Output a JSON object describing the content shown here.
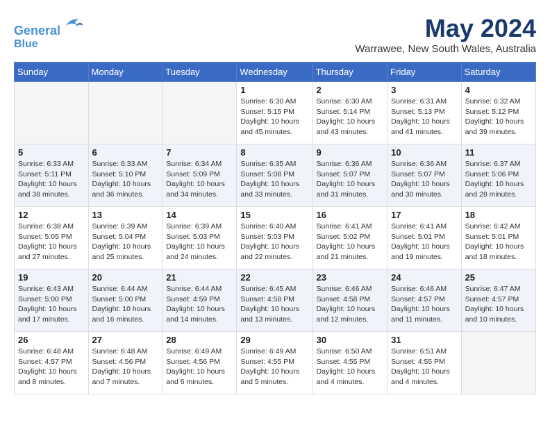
{
  "header": {
    "logo_line1": "General",
    "logo_line2": "Blue",
    "month": "May 2024",
    "location": "Warrawee, New South Wales, Australia"
  },
  "weekdays": [
    "Sunday",
    "Monday",
    "Tuesday",
    "Wednesday",
    "Thursday",
    "Friday",
    "Saturday"
  ],
  "weeks": [
    [
      {
        "day": "",
        "sunrise": "",
        "sunset": "",
        "daylight": ""
      },
      {
        "day": "",
        "sunrise": "",
        "sunset": "",
        "daylight": ""
      },
      {
        "day": "",
        "sunrise": "",
        "sunset": "",
        "daylight": ""
      },
      {
        "day": "1",
        "sunrise": "Sunrise: 6:30 AM",
        "sunset": "Sunset: 5:15 PM",
        "daylight": "Daylight: 10 hours and 45 minutes."
      },
      {
        "day": "2",
        "sunrise": "Sunrise: 6:30 AM",
        "sunset": "Sunset: 5:14 PM",
        "daylight": "Daylight: 10 hours and 43 minutes."
      },
      {
        "day": "3",
        "sunrise": "Sunrise: 6:31 AM",
        "sunset": "Sunset: 5:13 PM",
        "daylight": "Daylight: 10 hours and 41 minutes."
      },
      {
        "day": "4",
        "sunrise": "Sunrise: 6:32 AM",
        "sunset": "Sunset: 5:12 PM",
        "daylight": "Daylight: 10 hours and 39 minutes."
      }
    ],
    [
      {
        "day": "5",
        "sunrise": "Sunrise: 6:33 AM",
        "sunset": "Sunset: 5:11 PM",
        "daylight": "Daylight: 10 hours and 38 minutes."
      },
      {
        "day": "6",
        "sunrise": "Sunrise: 6:33 AM",
        "sunset": "Sunset: 5:10 PM",
        "daylight": "Daylight: 10 hours and 36 minutes."
      },
      {
        "day": "7",
        "sunrise": "Sunrise: 6:34 AM",
        "sunset": "Sunset: 5:09 PM",
        "daylight": "Daylight: 10 hours and 34 minutes."
      },
      {
        "day": "8",
        "sunrise": "Sunrise: 6:35 AM",
        "sunset": "Sunset: 5:08 PM",
        "daylight": "Daylight: 10 hours and 33 minutes."
      },
      {
        "day": "9",
        "sunrise": "Sunrise: 6:36 AM",
        "sunset": "Sunset: 5:07 PM",
        "daylight": "Daylight: 10 hours and 31 minutes."
      },
      {
        "day": "10",
        "sunrise": "Sunrise: 6:36 AM",
        "sunset": "Sunset: 5:07 PM",
        "daylight": "Daylight: 10 hours and 30 minutes."
      },
      {
        "day": "11",
        "sunrise": "Sunrise: 6:37 AM",
        "sunset": "Sunset: 5:06 PM",
        "daylight": "Daylight: 10 hours and 28 minutes."
      }
    ],
    [
      {
        "day": "12",
        "sunrise": "Sunrise: 6:38 AM",
        "sunset": "Sunset: 5:05 PM",
        "daylight": "Daylight: 10 hours and 27 minutes."
      },
      {
        "day": "13",
        "sunrise": "Sunrise: 6:39 AM",
        "sunset": "Sunset: 5:04 PM",
        "daylight": "Daylight: 10 hours and 25 minutes."
      },
      {
        "day": "14",
        "sunrise": "Sunrise: 6:39 AM",
        "sunset": "Sunset: 5:03 PM",
        "daylight": "Daylight: 10 hours and 24 minutes."
      },
      {
        "day": "15",
        "sunrise": "Sunrise: 6:40 AM",
        "sunset": "Sunset: 5:03 PM",
        "daylight": "Daylight: 10 hours and 22 minutes."
      },
      {
        "day": "16",
        "sunrise": "Sunrise: 6:41 AM",
        "sunset": "Sunset: 5:02 PM",
        "daylight": "Daylight: 10 hours and 21 minutes."
      },
      {
        "day": "17",
        "sunrise": "Sunrise: 6:41 AM",
        "sunset": "Sunset: 5:01 PM",
        "daylight": "Daylight: 10 hours and 19 minutes."
      },
      {
        "day": "18",
        "sunrise": "Sunrise: 6:42 AM",
        "sunset": "Sunset: 5:01 PM",
        "daylight": "Daylight: 10 hours and 18 minutes."
      }
    ],
    [
      {
        "day": "19",
        "sunrise": "Sunrise: 6:43 AM",
        "sunset": "Sunset: 5:00 PM",
        "daylight": "Daylight: 10 hours and 17 minutes."
      },
      {
        "day": "20",
        "sunrise": "Sunrise: 6:44 AM",
        "sunset": "Sunset: 5:00 PM",
        "daylight": "Daylight: 10 hours and 16 minutes."
      },
      {
        "day": "21",
        "sunrise": "Sunrise: 6:44 AM",
        "sunset": "Sunset: 4:59 PM",
        "daylight": "Daylight: 10 hours and 14 minutes."
      },
      {
        "day": "22",
        "sunrise": "Sunrise: 6:45 AM",
        "sunset": "Sunset: 4:58 PM",
        "daylight": "Daylight: 10 hours and 13 minutes."
      },
      {
        "day": "23",
        "sunrise": "Sunrise: 6:46 AM",
        "sunset": "Sunset: 4:58 PM",
        "daylight": "Daylight: 10 hours and 12 minutes."
      },
      {
        "day": "24",
        "sunrise": "Sunrise: 6:46 AM",
        "sunset": "Sunset: 4:57 PM",
        "daylight": "Daylight: 10 hours and 11 minutes."
      },
      {
        "day": "25",
        "sunrise": "Sunrise: 6:47 AM",
        "sunset": "Sunset: 4:57 PM",
        "daylight": "Daylight: 10 hours and 10 minutes."
      }
    ],
    [
      {
        "day": "26",
        "sunrise": "Sunrise: 6:48 AM",
        "sunset": "Sunset: 4:57 PM",
        "daylight": "Daylight: 10 hours and 8 minutes."
      },
      {
        "day": "27",
        "sunrise": "Sunrise: 6:48 AM",
        "sunset": "Sunset: 4:56 PM",
        "daylight": "Daylight: 10 hours and 7 minutes."
      },
      {
        "day": "28",
        "sunrise": "Sunrise: 6:49 AM",
        "sunset": "Sunset: 4:56 PM",
        "daylight": "Daylight: 10 hours and 6 minutes."
      },
      {
        "day": "29",
        "sunrise": "Sunrise: 6:49 AM",
        "sunset": "Sunset: 4:55 PM",
        "daylight": "Daylight: 10 hours and 5 minutes."
      },
      {
        "day": "30",
        "sunrise": "Sunrise: 6:50 AM",
        "sunset": "Sunset: 4:55 PM",
        "daylight": "Daylight: 10 hours and 4 minutes."
      },
      {
        "day": "31",
        "sunrise": "Sunrise: 6:51 AM",
        "sunset": "Sunset: 4:55 PM",
        "daylight": "Daylight: 10 hours and 4 minutes."
      },
      {
        "day": "",
        "sunrise": "",
        "sunset": "",
        "daylight": ""
      }
    ]
  ]
}
